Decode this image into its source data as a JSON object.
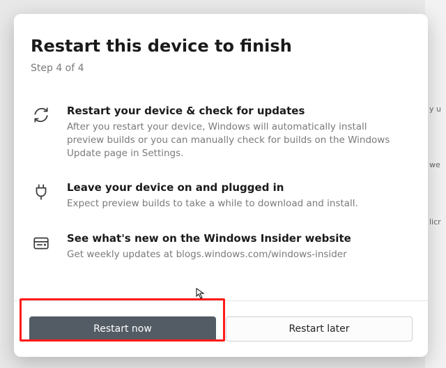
{
  "dialog": {
    "title": "Restart this device to finish",
    "step": "Step 4 of 4",
    "items": [
      {
        "heading": "Restart your device & check for updates",
        "body": "After you restart your device, Windows will automatically install preview builds or you can manually check for builds on the Windows Update page in Settings."
      },
      {
        "heading": "Leave your device on and plugged in",
        "body": "Expect preview builds to take a while to download and install."
      },
      {
        "heading": "See what's new on the Windows Insider website",
        "body": "Get weekly updates at blogs.windows.com/windows-insider"
      }
    ],
    "buttons": {
      "primary": "Restart now",
      "secondary": "Restart later"
    }
  },
  "backdrop": {
    "t1": "y u",
    "t2": "we",
    "t3": "licr"
  }
}
